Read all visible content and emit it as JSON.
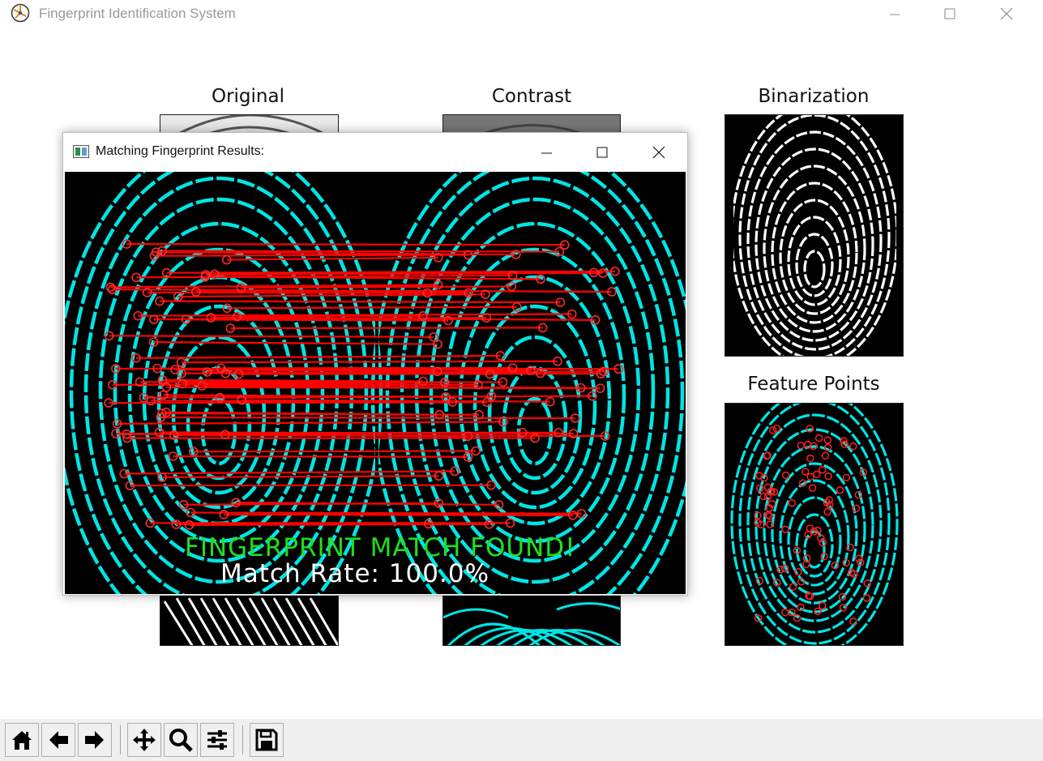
{
  "window": {
    "title": "Fingerprint Identification System"
  },
  "figures": {
    "original": "Original",
    "contrast": "Contrast",
    "binarization": "Binarization",
    "feature_points": "Feature Points"
  },
  "dialog": {
    "title": "Matching Fingerprint Results:",
    "status_text": "FINGERPRINT MATCH FOUND!",
    "match_rate_text": "Match Rate: 100.0%",
    "status_color": "#1ee01e",
    "ridge_color": "#00e5e5",
    "match_line_color": "#ff0000"
  },
  "toolbar": {
    "buttons": [
      "home-icon",
      "back-icon",
      "forward-icon",
      "pan-icon",
      "zoom-icon",
      "configure-icon",
      "save-icon"
    ]
  }
}
